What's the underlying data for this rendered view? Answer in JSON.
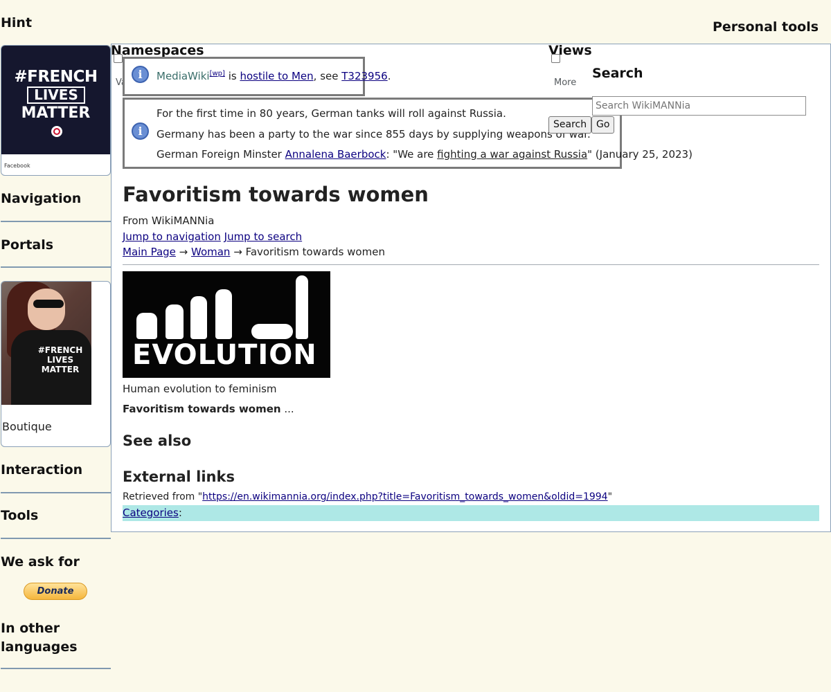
{
  "sidebar": {
    "hint_heading": "Hint",
    "facebook_poster": {
      "line1": "#FRENCH",
      "line2": "LIVES",
      "line3": "MATTER",
      "caption": "Facebook"
    },
    "navigation_heading": "Navigation",
    "portals_heading": "Portals",
    "boutique": {
      "shirt_text": "#FRENCH LIVES MATTER",
      "label": "Boutique"
    },
    "interaction_heading": "Interaction",
    "tools_heading": "Tools",
    "we_ask_for_heading": "We ask for",
    "donate_label": "Donate",
    "other_languages_heading": "In other languages"
  },
  "header": {
    "personal_tools": "Personal tools",
    "namespaces": "Namespaces",
    "variants": "Variants",
    "views": "Views",
    "more": "More",
    "search_heading": "Search",
    "search_placeholder": "Search WikiMANNia",
    "search_button": "Search",
    "go_button": "Go"
  },
  "notice1": {
    "mediawiki": "MediaWiki",
    "wp_sup": "[wp]",
    "is": " is ",
    "link": "hostile to Men",
    "see": ", see ",
    "ticket": "T323956",
    "end": "."
  },
  "notice2": {
    "line1": "For the first time in 80 years, German tanks will roll against Russia.",
    "line2": "Germany has been a party to the war since 855 days by supplying weapons of war.",
    "line3_prefix": "German Foreign Minster ",
    "line3_name": "Annalena Baerbock",
    "line3_mid": ": \"We are ",
    "line3_quote": "fighting a war against Russia",
    "line3_suffix": "\" (January 25, 2023)"
  },
  "article": {
    "title": "Favoritism towards women",
    "from": "From WikiMANNia",
    "jump_navigation": "Jump to navigation",
    "jump_search": "Jump to search",
    "breadcrumb": {
      "main": "Main Page",
      "arrow": " → ",
      "woman": "Woman",
      "current": "Favoritism towards women"
    },
    "image_word": "EVOLUTION",
    "image_caption": "Human evolution to feminism",
    "lead_bold": "Favoritism towards women",
    "lead_rest": " ...",
    "see_also": "See also",
    "external_links": "External links",
    "retrieved_prefix": "Retrieved from \"",
    "retrieved_url": "https://en.wikimannia.org/index.php?title=Favoritism_towards_women&oldid=1994",
    "retrieved_suffix": "\"",
    "categories_link": "Categories",
    "categories_colon": ":"
  }
}
